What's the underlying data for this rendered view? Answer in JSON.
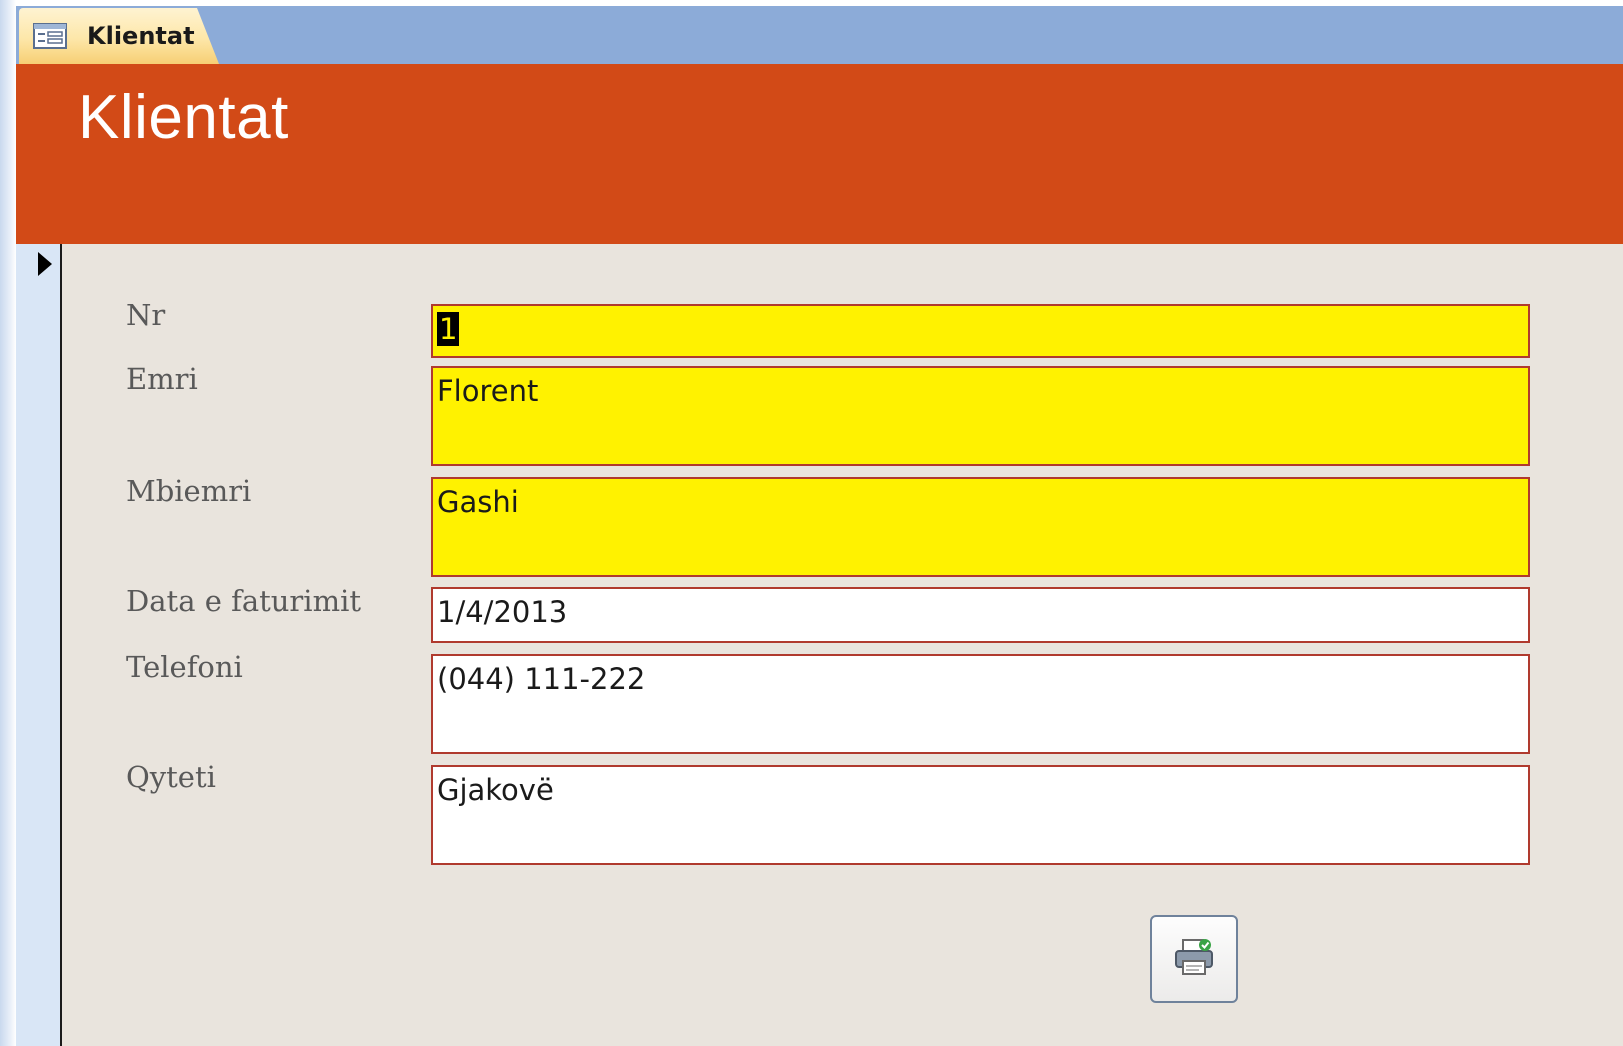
{
  "tab": {
    "label": "Klientat",
    "icon": "form-icon"
  },
  "header": {
    "title": "Klientat",
    "color": "#d24a17"
  },
  "record_selector": {
    "icon": "current-record-arrow-icon"
  },
  "fields": [
    {
      "label": "Nr",
      "value": "1",
      "required": true
    },
    {
      "label": "Emri",
      "value": "Florent",
      "required": true
    },
    {
      "label": "Mbiemri",
      "value": "Gashi",
      "required": true
    },
    {
      "label": "Data e faturimit",
      "value": "1/4/2013",
      "required": false
    },
    {
      "label": "Telefoni",
      "value": "(044) 111-222",
      "required": false
    },
    {
      "label": "Qyteti",
      "value": "Gjakovë",
      "required": false
    }
  ],
  "print_button": {
    "icon": "printer-icon"
  },
  "colors": {
    "required_field_bg": "#fff200",
    "field_border": "#b03a2e",
    "detail_bg": "#e9e4dd",
    "tab_strip": "#8cabd8"
  }
}
